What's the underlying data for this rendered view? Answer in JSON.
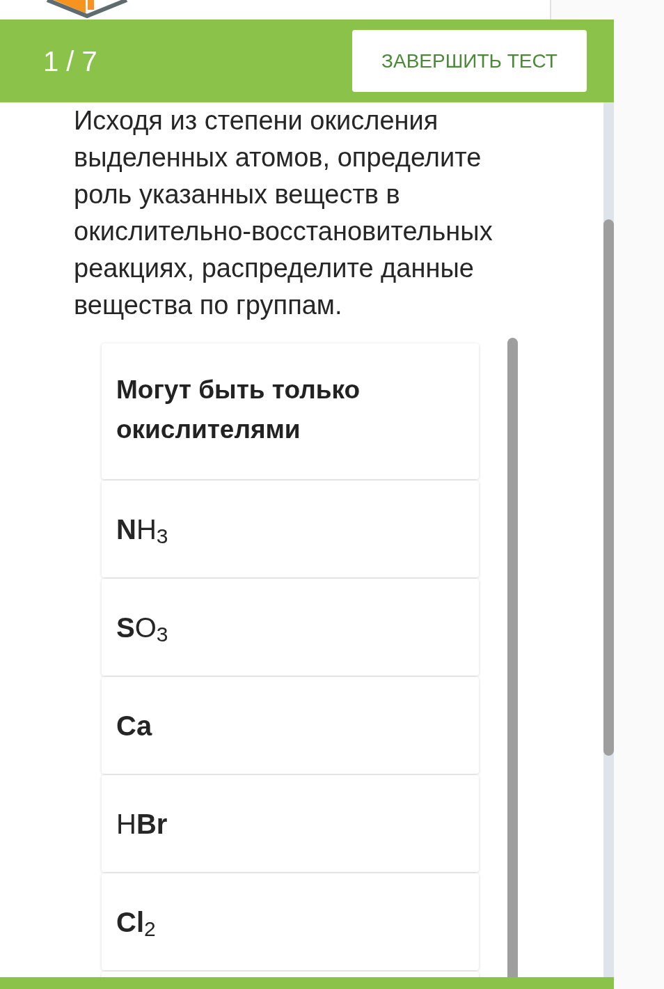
{
  "header": {
    "progress": "1 / 7",
    "finish_button": "ЗАВЕРШИТЬ ТЕСТ"
  },
  "question": {
    "text": "Исходя из степени окисления выделенных атомов, определите роль указанных веществ в окислительно-восстановительных реакциях, распределите данные вещества по группам."
  },
  "group": {
    "title": "Могут быть только окислителями",
    "items": [
      {
        "formula": "**N**H$_{3}$",
        "bold": false
      },
      {
        "formula": "**S**O$_{3}$",
        "bold": false
      },
      {
        "formula": "Ca",
        "bold": true
      },
      {
        "formula": "H**Br**",
        "bold": false
      },
      {
        "formula": "**Cl**$_{2}$",
        "bold": false
      }
    ]
  }
}
